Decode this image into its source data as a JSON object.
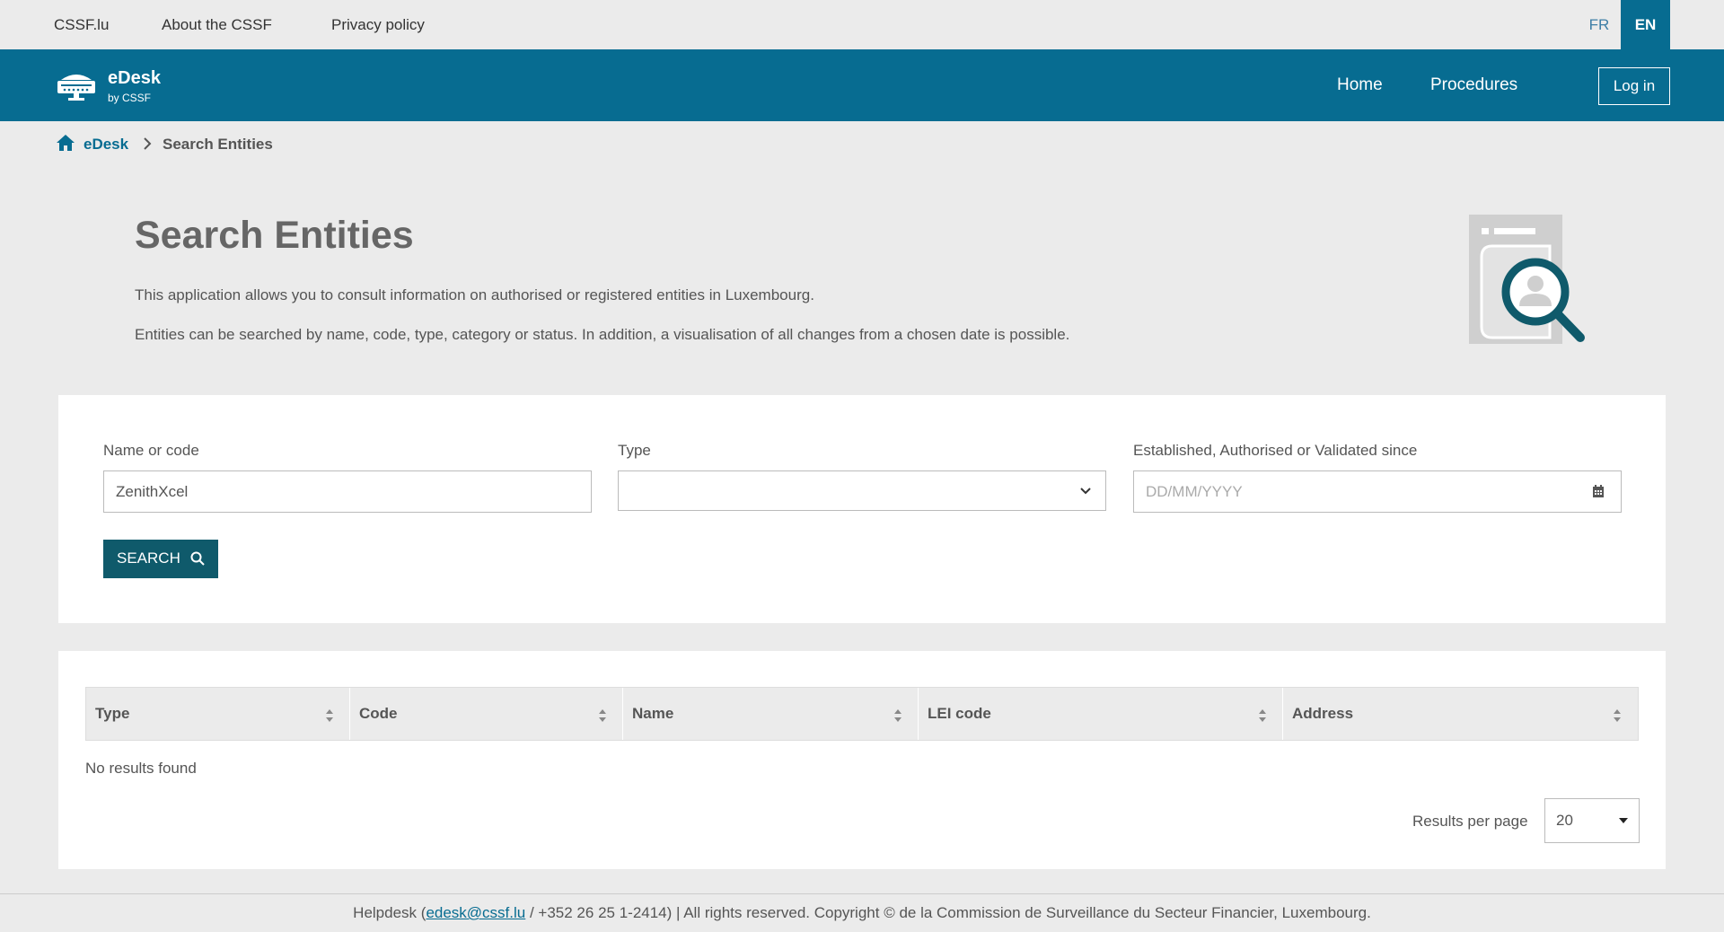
{
  "topbar": {
    "links": [
      "CSSF.lu",
      "About the CSSF",
      "Privacy policy"
    ],
    "lang_fr": "FR",
    "lang_en": "EN"
  },
  "header": {
    "app_name": "eDesk",
    "app_sub": "by CSSF",
    "nav_home": "Home",
    "nav_procedures": "Procedures",
    "login": "Log in"
  },
  "breadcrumb": {
    "root": "eDesk",
    "current": "Search Entities"
  },
  "intro": {
    "title": "Search Entities",
    "line1": "This application allows you to consult information on authorised or registered entities in Luxembourg.",
    "line2": "Entities can be searched by name, code, type, category or status. In addition, a visualisation of all changes from a chosen date is possible."
  },
  "search": {
    "name_label": "Name or code",
    "name_value": "ZenithXcel",
    "type_label": "Type",
    "type_value": "",
    "date_label": "Established, Authorised or Validated since",
    "date_placeholder": "DD/MM/YYYY",
    "button": "SEARCH"
  },
  "results": {
    "columns": [
      "Type",
      "Code",
      "Name",
      "LEI code",
      "Address"
    ],
    "empty_message": "No results found",
    "per_page_label": "Results per page",
    "per_page_value": "20"
  },
  "footer": {
    "prefix": "Helpdesk (",
    "email": "edesk@cssf.lu",
    "suffix": " / +352 26 25 1-2414) | All rights reserved. Copyright © de la Commission de Surveillance du Secteur Financier, Luxembourg."
  },
  "colors": {
    "brand": "#076c91",
    "button": "#0f5a6b"
  }
}
